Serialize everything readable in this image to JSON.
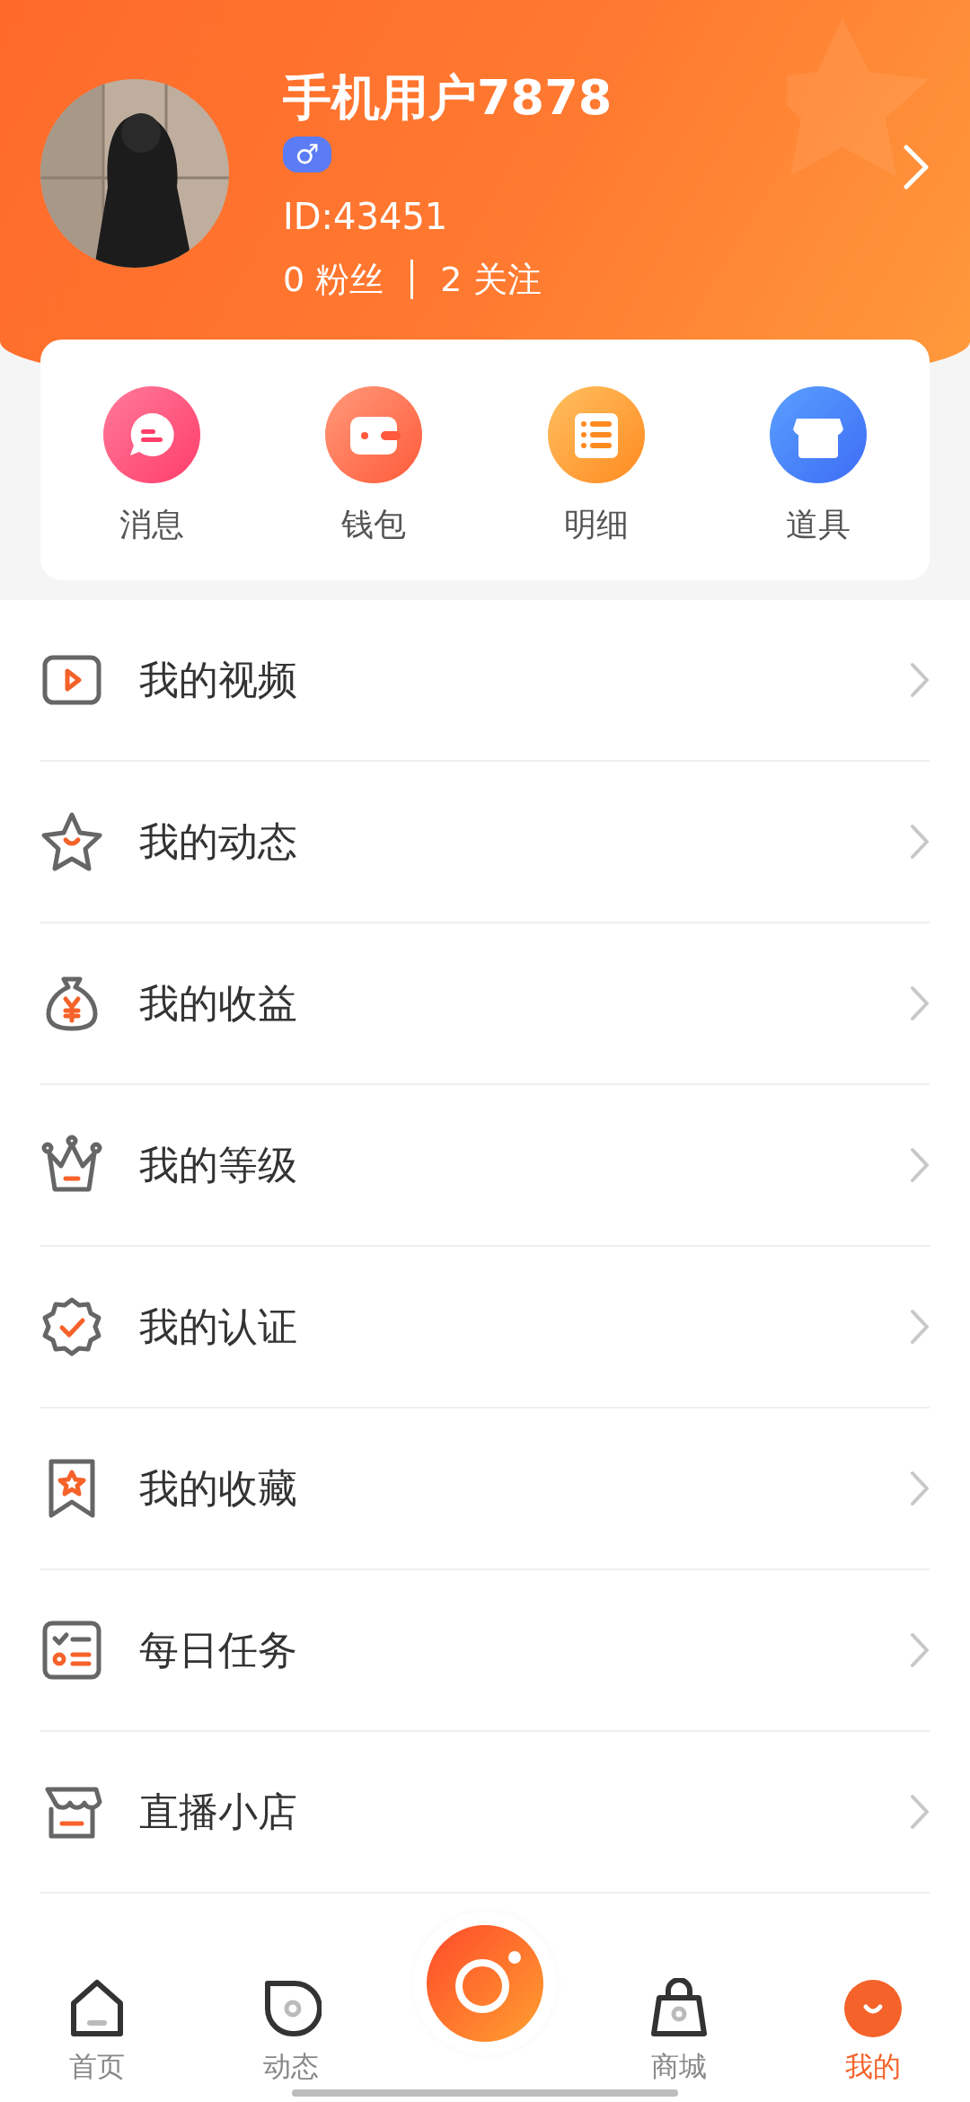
{
  "profile": {
    "name": "手机用户7878",
    "gender_symbol": "♂",
    "id": "ID:43451",
    "fans": "0 粉丝",
    "following": "2 关注"
  },
  "shortcuts": [
    {
      "label": "消息",
      "kind": "message"
    },
    {
      "label": "钱包",
      "kind": "wallet"
    },
    {
      "label": "明细",
      "kind": "list"
    },
    {
      "label": "道具",
      "kind": "shop"
    }
  ],
  "menu": [
    {
      "label": "我的视频",
      "kind": "video"
    },
    {
      "label": "我的动态",
      "kind": "star"
    },
    {
      "label": "我的收益",
      "kind": "moneybag"
    },
    {
      "label": "我的等级",
      "kind": "crown"
    },
    {
      "label": "我的认证",
      "kind": "badge"
    },
    {
      "label": "我的收藏",
      "kind": "bookmark"
    },
    {
      "label": "每日任务",
      "kind": "tasks"
    },
    {
      "label": "直播小店",
      "kind": "store"
    }
  ],
  "tab_bar": [
    {
      "label": "首页",
      "kind": "home",
      "selected": false
    },
    {
      "label": "动态",
      "kind": "moment",
      "selected": false
    },
    {
      "kind": "camera",
      "selected": false
    },
    {
      "label": "商城",
      "kind": "bag",
      "selected": false
    },
    {
      "label": "我的",
      "kind": "me",
      "selected": true
    }
  ]
}
